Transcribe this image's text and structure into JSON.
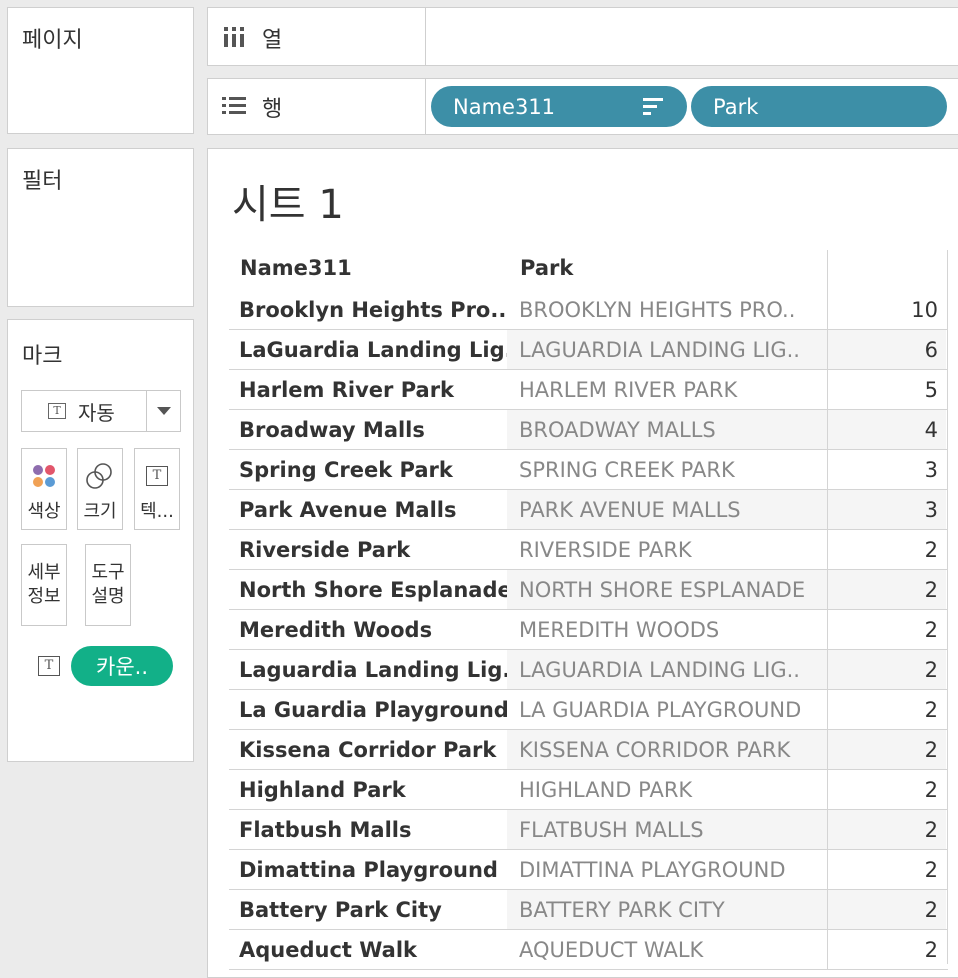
{
  "panes": {
    "pages_label": "페이지",
    "filters_label": "필터",
    "marks": {
      "title": "마크",
      "mark_type": "자동",
      "buttons": [
        "색상",
        "크기",
        "텍..."
      ],
      "buttons2": [
        [
          "세부",
          "정보"
        ],
        [
          "도구",
          "설명"
        ]
      ],
      "pill": "카운.."
    }
  },
  "shelves": {
    "columns_label": "열",
    "rows_label": "행",
    "row_pills": [
      "Name311",
      "Park"
    ]
  },
  "sheet": {
    "title": "시트 1",
    "headers": [
      "Name311",
      "Park"
    ],
    "rows": [
      [
        "Brooklyn Heights Pro..",
        "BROOKLYN HEIGHTS PRO..",
        "10"
      ],
      [
        "LaGuardia Landing Lig..",
        "LAGUARDIA LANDING LIG..",
        "6"
      ],
      [
        "Harlem River Park",
        "HARLEM RIVER PARK",
        "5"
      ],
      [
        "Broadway Malls",
        "BROADWAY MALLS",
        "4"
      ],
      [
        "Spring Creek Park",
        "SPRING CREEK PARK",
        "3"
      ],
      [
        "Park Avenue Malls",
        "PARK AVENUE MALLS",
        "3"
      ],
      [
        "Riverside Park",
        "RIVERSIDE PARK",
        "2"
      ],
      [
        "North Shore Esplanade",
        "NORTH SHORE ESPLANADE",
        "2"
      ],
      [
        "Meredith Woods",
        "MEREDITH WOODS",
        "2"
      ],
      [
        "Laguardia Landing Lig..",
        "LAGUARDIA LANDING LIG..",
        "2"
      ],
      [
        "La Guardia Playground",
        "LA GUARDIA PLAYGROUND",
        "2"
      ],
      [
        "Kissena Corridor Park",
        "KISSENA CORRIDOR PARK",
        "2"
      ],
      [
        "Highland Park",
        "HIGHLAND PARK",
        "2"
      ],
      [
        "Flatbush Malls",
        "FLATBUSH MALLS",
        "2"
      ],
      [
        "Dimattina Playground",
        "DIMATTINA PLAYGROUND",
        "2"
      ],
      [
        "Battery Park City",
        "BATTERY PARK CITY",
        "2"
      ],
      [
        "Aqueduct Walk",
        "AQUEDUCT WALK",
        "2"
      ]
    ]
  },
  "colors": {
    "pill_blue": "#3d8fa7",
    "pill_green": "#12b088"
  }
}
